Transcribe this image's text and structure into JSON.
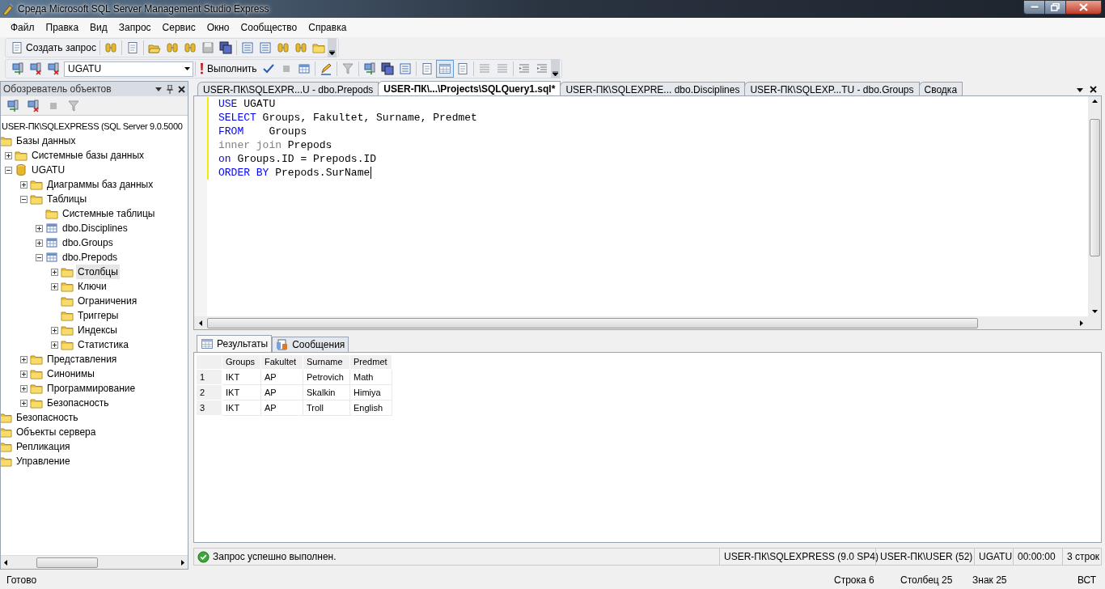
{
  "window": {
    "title": "Среда Microsoft SQL Server Management Studio Express"
  },
  "menu": [
    "Файл",
    "Правка",
    "Вид",
    "Запрос",
    "Сервис",
    "Окно",
    "Сообщество",
    "Справка"
  ],
  "toolbar": {
    "new_query": "Создать запрос",
    "database": "UGATU",
    "execute": "Выполнить"
  },
  "object_explorer": {
    "title": "Обозреватель объектов",
    "server": {
      "label": "USER-ПК\\SQLEXPRESS (SQL Server 9.0.5000",
      "children": [
        {
          "label": "Базы данных",
          "kind": "folder",
          "selected": false,
          "children": [
            {
              "label": "Системные базы данных",
              "kind": "folder",
              "expanded": false,
              "selected": false
            },
            {
              "label": "UGATU",
              "kind": "database",
              "expanded": true,
              "selected": false,
              "children": [
                {
                  "label": "Диаграммы баз данных",
                  "kind": "folder",
                  "expanded": false,
                  "selected": false
                },
                {
                  "label": "Таблицы",
                  "kind": "folder",
                  "expanded": true,
                  "selected": false,
                  "children": [
                    {
                      "label": "Системные таблицы",
                      "kind": "folder",
                      "selected": false
                    },
                    {
                      "label": "dbo.Disciplines",
                      "kind": "table",
                      "expanded": false,
                      "selected": false
                    },
                    {
                      "label": "dbo.Groups",
                      "kind": "table",
                      "expanded": false,
                      "selected": false
                    },
                    {
                      "label": "dbo.Prepods",
                      "kind": "table",
                      "expanded": true,
                      "selected": false,
                      "children": [
                        {
                          "label": "Столбцы",
                          "kind": "folder",
                          "expanded": false,
                          "selected": true
                        },
                        {
                          "label": "Ключи",
                          "kind": "folder",
                          "expanded": false,
                          "selected": false
                        },
                        {
                          "label": "Ограничения",
                          "kind": "folder",
                          "selected": false
                        },
                        {
                          "label": "Триггеры",
                          "kind": "folder",
                          "selected": false
                        },
                        {
                          "label": "Индексы",
                          "kind": "folder",
                          "expanded": false,
                          "selected": false
                        },
                        {
                          "label": "Статистика",
                          "kind": "folder",
                          "expanded": false,
                          "selected": false
                        }
                      ]
                    }
                  ]
                },
                {
                  "label": "Представления",
                  "kind": "folder",
                  "expanded": false,
                  "selected": false
                },
                {
                  "label": "Синонимы",
                  "kind": "folder",
                  "expanded": false,
                  "selected": false
                },
                {
                  "label": "Программирование",
                  "kind": "folder",
                  "expanded": false,
                  "selected": false
                },
                {
                  "label": "Безопасность",
                  "kind": "folder",
                  "expanded": false,
                  "selected": false
                }
              ]
            }
          ]
        },
        {
          "label": "Безопасность",
          "kind": "folder",
          "selected": false
        },
        {
          "label": "Объекты сервера",
          "kind": "folder",
          "selected": false
        },
        {
          "label": "Репликация",
          "kind": "folder",
          "selected": false
        },
        {
          "label": "Управление",
          "kind": "folder",
          "selected": false
        }
      ]
    }
  },
  "document_tabs": [
    {
      "label": "USER-ПК\\SQLEXPR...U - dbo.Prepods",
      "selected": false
    },
    {
      "label": "USER-ПК\\...\\Projects\\SQLQuery1.sql*",
      "selected": true
    },
    {
      "label": "USER-ПК\\SQLEXPRE... dbo.Disciplines",
      "selected": false
    },
    {
      "label": "USER-ПК\\SQLEXP...TU - dbo.Groups",
      "selected": false
    },
    {
      "label": "Сводка",
      "selected": false
    }
  ],
  "editor": {
    "lines": [
      [
        {
          "text": "USE",
          "kind": "keyword"
        },
        {
          "text": " UGATU",
          "kind": "plain"
        }
      ],
      [
        {
          "text": "SELECT",
          "kind": "keyword"
        },
        {
          "text": " Groups, Fakultet, Surname, Predmet",
          "kind": "plain"
        }
      ],
      [
        {
          "text": "FROM",
          "kind": "keyword"
        },
        {
          "text": "    Groups",
          "kind": "plain"
        }
      ],
      [
        {
          "text": "inner join",
          "kind": "operator"
        },
        {
          "text": " Prepods",
          "kind": "plain"
        }
      ],
      [
        {
          "text": "on",
          "kind": "keyword"
        },
        {
          "text": " Groups.ID = Prepods.ID",
          "kind": "plain"
        }
      ],
      [
        {
          "text": "ORDER BY",
          "kind": "keyword"
        },
        {
          "text": " Prepods.SurName",
          "kind": "plain"
        }
      ]
    ]
  },
  "result_tabs": [
    {
      "label": "Результаты",
      "selected": true
    },
    {
      "label": "Сообщения",
      "selected": false
    }
  ],
  "results": {
    "columns": [
      "Groups",
      "Fakultet",
      "Surname",
      "Predmet"
    ],
    "rows": [
      {
        "number": "1",
        "cells": [
          "IKT",
          "AP",
          "Petrovich",
          "Math"
        ]
      },
      {
        "number": "2",
        "cells": [
          "IKT",
          "AP",
          "Skalkin",
          "Himiya"
        ]
      },
      {
        "number": "3",
        "cells": [
          "IKT",
          "AP",
          "Troll",
          "English"
        ]
      }
    ]
  },
  "query_status": {
    "message": "Запрос успешно выполнен.",
    "server": "USER-ПК\\SQLEXPRESS (9.0 SP4)",
    "user": "USER-ПК\\USER (52)",
    "database": "UGATU",
    "elapsed": "00:00:00",
    "rows": "3 строк"
  },
  "status_bar": {
    "state": "Готово",
    "line": "Строка 6",
    "column": "Столбец 25",
    "char": "Знак 25",
    "mode": "ВСТ"
  }
}
